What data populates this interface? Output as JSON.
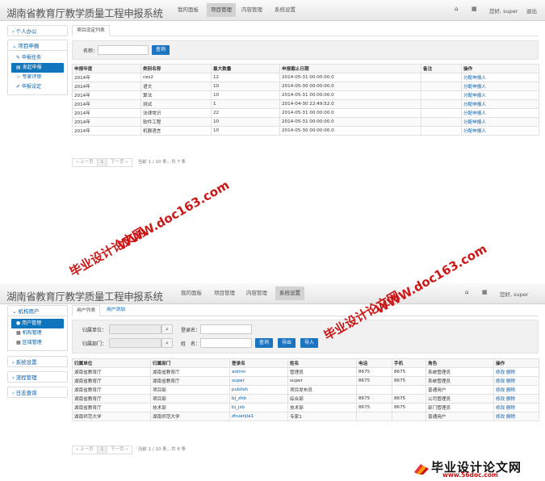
{
  "watermarks": {
    "url": "WWW.doc163.com",
    "name": "毕业设计论文网"
  },
  "logo": {
    "title": "毕业设计论文网",
    "url": "www.56doc.com"
  },
  "shot1": {
    "brand": "湖南省教育厅教学质量工程申报系统",
    "nav": [
      "我的面板",
      "项目管理",
      "内容管理",
      "系统设置"
    ],
    "user": "您好, super",
    "logout": "退出",
    "sidebar": {
      "group1": "个人办公",
      "group2": "项目申报",
      "items": [
        "申报任务",
        "发起申报",
        "专家评审",
        "申报设定"
      ]
    },
    "tab": "项目设定列表",
    "search": {
      "label": "名称：",
      "button": "查询"
    },
    "table": {
      "headers": [
        "申报年度",
        "类别名称",
        "最大数量",
        "申报截止日期",
        "备注",
        "操作"
      ],
      "rows": [
        [
          "2014年",
          "ces2",
          "12",
          "2014-05-31 00:00:00.0",
          "",
          "分配申报人"
        ],
        [
          "2014年",
          "语文",
          "10",
          "2014-05-30 00:00:00.0",
          "",
          "分配申报人"
        ],
        [
          "2014年",
          "算法",
          "10",
          "2014-05-31 00:00:00.0",
          "",
          "分配申报人"
        ],
        [
          "2014年",
          "测试",
          "1",
          "2014-04-30 22:49:52.0",
          "",
          "分配申报人"
        ],
        [
          "2014年",
          "法律常识",
          "22",
          "2014-05-31 00:00:00.0",
          "",
          "分配申报人"
        ],
        [
          "2014年",
          "软件工程",
          "10",
          "2014-05-31 00:00:00.0",
          "",
          "分配申报人"
        ],
        [
          "2014年",
          "机器语言",
          "10",
          "2014-05-30 00:00:00.0",
          "",
          "分配申报人"
        ]
      ]
    },
    "pager": {
      "prev": "« 上一页",
      "page": "1",
      "next": "下一页 »",
      "info": "当前 1 / 10 条，共 7 条"
    }
  },
  "shot2": {
    "brand": "湖南省教育厅教学质量工程申报系统",
    "nav": [
      "我的面板",
      "项目管理",
      "内容管理",
      "系统设置"
    ],
    "user": "您好, super",
    "sidebar": {
      "group1": "机构用户",
      "items": [
        "用户管理",
        "机构管理",
        "区域管理"
      ],
      "group2": "系统设置",
      "group3": "流程管理",
      "group4": "日志查询"
    },
    "tabs": [
      "用户列表",
      "用户添加"
    ],
    "search": {
      "unit_label": "归属单位：",
      "login_label": "登录名：",
      "dept_label": "归属部门：",
      "name_label": "姓　名：",
      "query": "查询",
      "export": "导出",
      "import": "导入"
    },
    "table": {
      "headers": [
        "归属单位",
        "归属部门",
        "登录名",
        "姓名",
        "电话",
        "手机",
        "角色",
        "操作"
      ],
      "rows": [
        [
          "湖南省教育厅",
          "湖南省教育厅",
          "admin",
          "管理员",
          "8675",
          "8675",
          "系统管理员",
          "修改 删除"
        ],
        [
          "湖南省教育厅",
          "湖南省教育厅",
          "super",
          "super",
          "8675",
          "8675",
          "系统管理员",
          "修改 删除"
        ],
        [
          "湖南省教育厅",
          "项目部",
          "publish",
          "项目发布员",
          "",
          "",
          "普通用户",
          "修改 删除"
        ],
        [
          "湖南省教育厅",
          "项目部",
          "bj_zhb",
          "综合部",
          "8675",
          "8675",
          "公司管理员",
          "修改 删除"
        ],
        [
          "湖南省教育厅",
          "技术部",
          "bj_jsb",
          "技术部",
          "8675",
          "8675",
          "部门管理员",
          "修改 删除"
        ],
        [
          "湖南师范大学",
          "湖南师范大学",
          "zhuanjia1",
          "专家1",
          "",
          "",
          "普通用户",
          "修改 删除"
        ]
      ]
    },
    "pager": {
      "prev": "« 上一页",
      "page": "1",
      "next": "下一页 »",
      "info": "当前 1 / 10 条，共 6 条"
    }
  }
}
